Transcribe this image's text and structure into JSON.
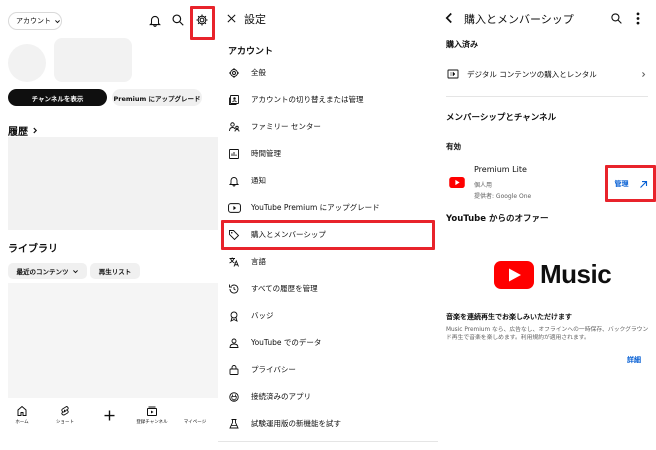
{
  "panel1": {
    "account_chip": "アカウント",
    "view_channel_button": "チャンネルを表示",
    "premium_upgrade_button": "Premium にアップグレード",
    "history_heading": "履歴",
    "library_heading": "ライブラリ",
    "recent_content_chip": "最近のコンテンツ",
    "playlists_chip": "再生リスト",
    "bottom_nav": [
      {
        "label": "ホーム",
        "icon": "home-icon"
      },
      {
        "label": "ショート",
        "icon": "shorts-icon"
      },
      {
        "label": "",
        "icon": "create-icon"
      },
      {
        "label": "登録チャンネル",
        "icon": "subscriptions-icon"
      },
      {
        "label": "マイページ",
        "icon": "you-icon"
      }
    ]
  },
  "panel2": {
    "title": "設定",
    "section": "アカウント",
    "items": [
      {
        "label": "全般",
        "icon": "gear-icon"
      },
      {
        "label": "アカウントの切り替えまたは管理",
        "icon": "switch-account-icon"
      },
      {
        "label": "ファミリー センター",
        "icon": "family-icon"
      },
      {
        "label": "時間管理",
        "icon": "time-management-icon"
      },
      {
        "label": "通知",
        "icon": "bell-icon"
      },
      {
        "label": "YouTube Premium にアップグレード",
        "icon": "youtube-icon"
      },
      {
        "label": "購入とメンバーシップ",
        "icon": "tag-icon"
      },
      {
        "label": "言語",
        "icon": "language-icon"
      },
      {
        "label": "すべての履歴を管理",
        "icon": "history-icon"
      },
      {
        "label": "バッジ",
        "icon": "badge-icon"
      },
      {
        "label": "YouTube でのデータ",
        "icon": "data-icon"
      },
      {
        "label": "プライバシー",
        "icon": "lock-icon"
      },
      {
        "label": "接続済みのアプリ",
        "icon": "connected-apps-icon"
      },
      {
        "label": "試験運用版の新機能を試す",
        "icon": "flask-icon"
      }
    ]
  },
  "panel3": {
    "title": "購入とメンバーシップ",
    "purchased_heading": "購入済み",
    "digital_content_row": "デジタル コンテンツの購入とレンタル",
    "memberships_heading": "メンバーシップとチャンネル",
    "active_label": "有効",
    "premium_lite": {
      "name": "Premium Lite",
      "plan": "個人用",
      "provider": "提供者: Google One",
      "manage_label": "管理"
    },
    "offers_heading": "YouTube からのオファー",
    "music_logo_text": "Music",
    "offer_title": "音楽を連続再生でお楽しみいただけます",
    "offer_desc": "Music Premium なら、広告なし、オフラインへの一時保存、バックグラウンド再生で音楽を楽しめます。利用規約が適用されます。",
    "details_link": "詳細"
  },
  "colors": {
    "highlight": "#e8232b",
    "youtube_red": "#ff0000",
    "link_blue": "#065fd4"
  }
}
